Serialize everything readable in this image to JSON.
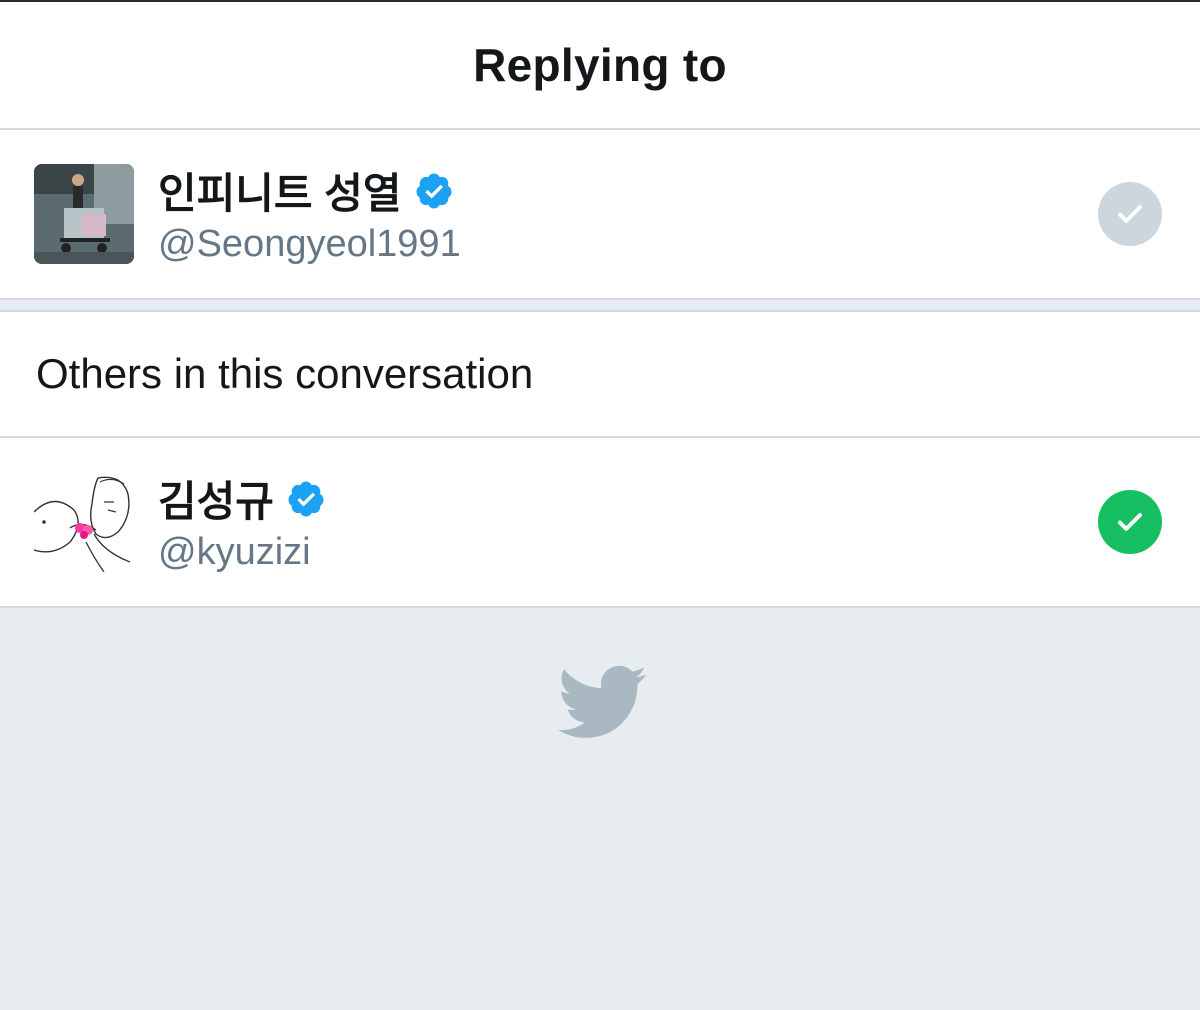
{
  "header": {
    "title": "Replying to"
  },
  "primary_user": {
    "display_name": "인피니트 성열",
    "handle": "@Seongyeol1991",
    "verified": true,
    "selected": false,
    "avatar_icon": "profile-photo"
  },
  "others_section": {
    "title": "Others in this conversation"
  },
  "other_users": [
    {
      "display_name": "김성규",
      "handle": "@kyuzizi",
      "verified": true,
      "selected": true,
      "avatar_icon": "sketch-illustration"
    }
  ],
  "footer": {
    "icon": "twitter-bird-icon"
  },
  "colors": {
    "verified_blue": "#1da1f2",
    "check_selected": "#17bf63",
    "check_unselected": "#ccd6dd",
    "background_gray": "#e6ecf0",
    "handle_gray": "#657786",
    "bird_gray": "#aab8c2"
  }
}
